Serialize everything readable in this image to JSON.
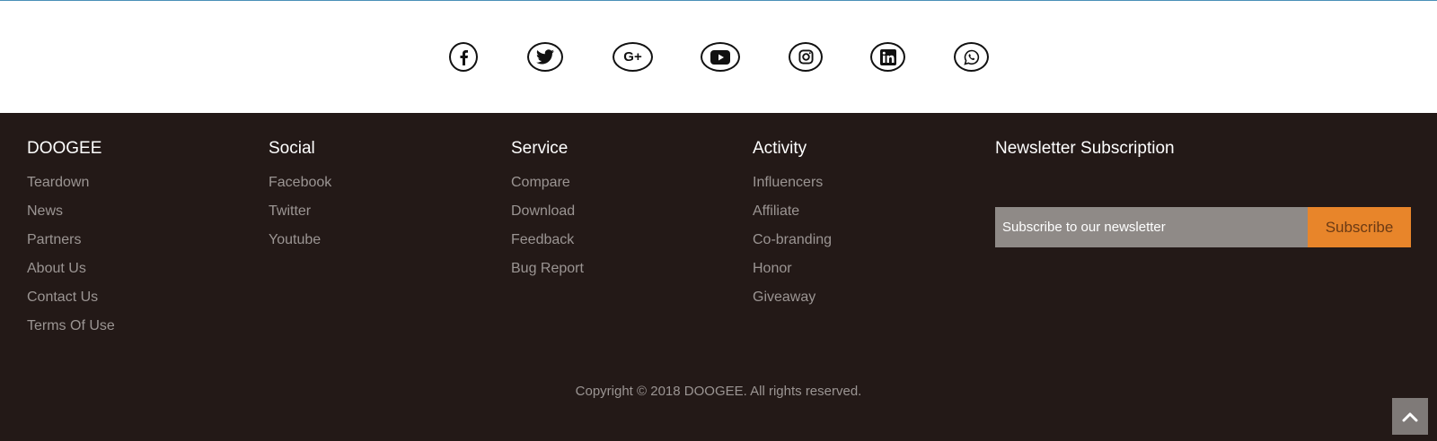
{
  "social_icons": [
    "facebook-icon",
    "twitter-icon",
    "google-plus-icon",
    "youtube-icon",
    "instagram-icon",
    "linkedin-icon",
    "whatsapp-icon"
  ],
  "social_icons_text": {
    "google_plus": "G+"
  },
  "columns": {
    "doogee": {
      "title": "DOOGEE",
      "items": [
        "Teardown",
        "News",
        "Partners",
        "About Us",
        "Contact Us",
        "Terms Of Use"
      ]
    },
    "social": {
      "title": "Social",
      "items": [
        "Facebook",
        "Twitter",
        "Youtube"
      ]
    },
    "service": {
      "title": "Service",
      "items": [
        "Compare",
        "Download",
        "Feedback",
        "Bug Report"
      ]
    },
    "activity": {
      "title": "Activity",
      "items": [
        "Influencers",
        "Affiliate",
        "Co-branding",
        "Honor",
        "Giveaway"
      ]
    }
  },
  "newsletter": {
    "title": "Newsletter Subscription",
    "placeholder": "Subscribe to our newsletter",
    "button_label": "Subscribe"
  },
  "copyright": "Copyright © 2018 DOOGEE. All rights reserved.",
  "colors": {
    "footer_bg": "#231917",
    "accent_orange": "#e8852a",
    "link_gray": "#9b9593",
    "top_line": "#4a90b8"
  }
}
